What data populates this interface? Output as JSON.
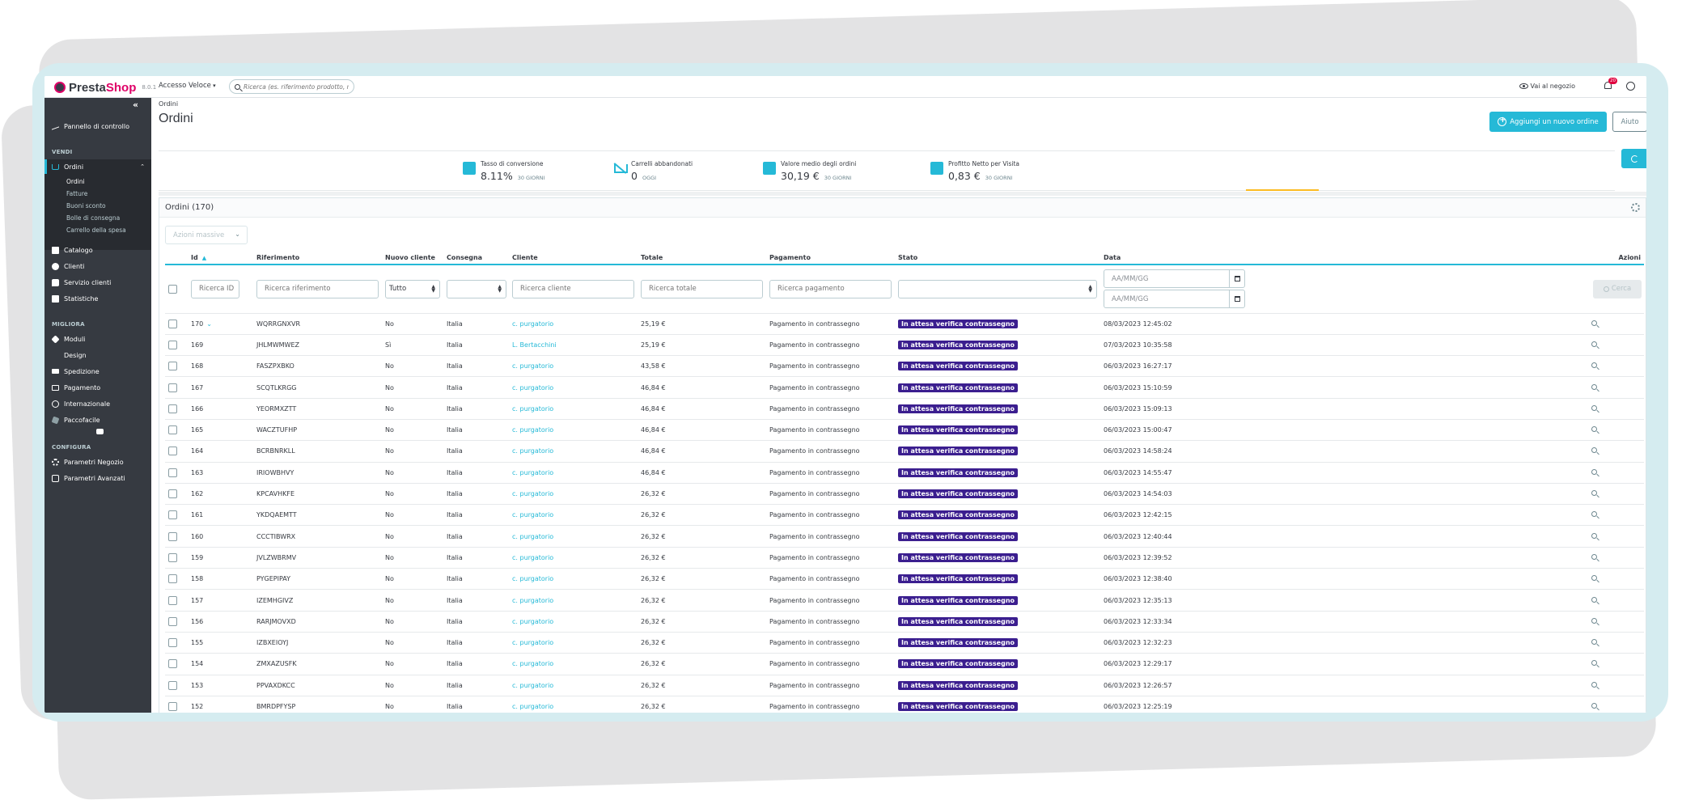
{
  "app": {
    "logo_main": "Presta",
    "logo_accent": "Shop",
    "version": "8.0.1",
    "quick_access": "Accesso Veloce",
    "search_placeholder": "Ricerca (es. riferimento prodotto, nom",
    "shop_link": "Vai al negozio",
    "notification_count": "20"
  },
  "sidebar": {
    "dashboard": "Pannello di controllo",
    "section_sell": "VENDI",
    "orders": "Ordini",
    "orders_sub": [
      "Ordini",
      "Fatture",
      "Buoni sconto",
      "Bolle di consegna",
      "Carrello della spesa"
    ],
    "catalog": "Catalogo",
    "customers": "Clienti",
    "customer_service": "Servizio clienti",
    "stats": "Statistiche",
    "section_improve": "MIGLIORA",
    "modules": "Moduli",
    "design": "Design",
    "shipping": "Spedizione",
    "payment": "Pagamento",
    "international": "Internazionale",
    "paccofacile": "Paccofacile",
    "section_configure": "CONFIGURA",
    "shop_params": "Parametri Negozio",
    "advanced_params": "Parametri Avanzati"
  },
  "header": {
    "breadcrumb": "Ordini",
    "title": "Ordini",
    "add_order": "Aggiungi un nuovo ordine",
    "help": "Aiuto"
  },
  "kpis": [
    {
      "label": "Tasso di conversione",
      "value": "8.11%",
      "period": "30 GIORNI"
    },
    {
      "label": "Carrelli abbandonati",
      "value": "0",
      "period": "OGGI"
    },
    {
      "label": "Valore medio degli ordini",
      "value": "30,19 €",
      "period": "30 GIORNI"
    },
    {
      "label": "Profitto Netto per Visita",
      "value": "0,83 €",
      "period": "30 GIORNI"
    }
  ],
  "panel": {
    "title": "Ordini (170)",
    "bulk_actions": "Azioni massive"
  },
  "table": {
    "headers": {
      "id": "Id",
      "reference": "Riferimento",
      "new_client": "Nuovo cliente",
      "delivery": "Consegna",
      "customer": "Cliente",
      "total": "Totale",
      "payment": "Pagamento",
      "status": "Stato",
      "date": "Data",
      "actions": "Azioni"
    },
    "filters": {
      "id": "Ricerca ID",
      "reference": "Ricerca riferimento",
      "new_client": "Tutto",
      "customer": "Ricerca cliente",
      "total": "Ricerca totale",
      "payment": "Ricerca pagamento",
      "date_from": "AA/MM/GG",
      "date_to": "AA/MM/GG",
      "search": "Cerca"
    },
    "rows": [
      {
        "id": "170",
        "ref": "WQRRGNXVR",
        "new": "No",
        "country": "Italia",
        "customer": "c. purgatorio",
        "total": "25,19 €",
        "payment": "Pagamento in contrassegno",
        "status": "In attesa verifica contrassegno",
        "date": "08/03/2023 12:45:02"
      },
      {
        "id": "169",
        "ref": "JHLMWMWEZ",
        "new": "Sì",
        "country": "Italia",
        "customer": "L. Bertacchini",
        "total": "25,19 €",
        "payment": "Pagamento in contrassegno",
        "status": "In attesa verifica contrassegno",
        "date": "07/03/2023 10:35:58"
      },
      {
        "id": "168",
        "ref": "FASZPXBKO",
        "new": "No",
        "country": "Italia",
        "customer": "c. purgatorio",
        "total": "43,58 €",
        "payment": "Pagamento in contrassegno",
        "status": "In attesa verifica contrassegno",
        "date": "06/03/2023 16:27:17"
      },
      {
        "id": "167",
        "ref": "SCQTLKRGG",
        "new": "No",
        "country": "Italia",
        "customer": "c. purgatorio",
        "total": "46,84 €",
        "payment": "Pagamento in contrassegno",
        "status": "In attesa verifica contrassegno",
        "date": "06/03/2023 15:10:59"
      },
      {
        "id": "166",
        "ref": "YEORMXZTT",
        "new": "No",
        "country": "Italia",
        "customer": "c. purgatorio",
        "total": "46,84 €",
        "payment": "Pagamento in contrassegno",
        "status": "In attesa verifica contrassegno",
        "date": "06/03/2023 15:09:13"
      },
      {
        "id": "165",
        "ref": "WACZTUFHP",
        "new": "No",
        "country": "Italia",
        "customer": "c. purgatorio",
        "total": "46,84 €",
        "payment": "Pagamento in contrassegno",
        "status": "In attesa verifica contrassegno",
        "date": "06/03/2023 15:00:47"
      },
      {
        "id": "164",
        "ref": "BCRBNRKLL",
        "new": "No",
        "country": "Italia",
        "customer": "c. purgatorio",
        "total": "46,84 €",
        "payment": "Pagamento in contrassegno",
        "status": "In attesa verifica contrassegno",
        "date": "06/03/2023 14:58:24"
      },
      {
        "id": "163",
        "ref": "IRIOWBHVY",
        "new": "No",
        "country": "Italia",
        "customer": "c. purgatorio",
        "total": "46,84 €",
        "payment": "Pagamento in contrassegno",
        "status": "In attesa verifica contrassegno",
        "date": "06/03/2023 14:55:47"
      },
      {
        "id": "162",
        "ref": "KPCAVHKFE",
        "new": "No",
        "country": "Italia",
        "customer": "c. purgatorio",
        "total": "26,32 €",
        "payment": "Pagamento in contrassegno",
        "status": "In attesa verifica contrassegno",
        "date": "06/03/2023 14:54:03"
      },
      {
        "id": "161",
        "ref": "YKDQAEMTT",
        "new": "No",
        "country": "Italia",
        "customer": "c. purgatorio",
        "total": "26,32 €",
        "payment": "Pagamento in contrassegno",
        "status": "In attesa verifica contrassegno",
        "date": "06/03/2023 12:42:15"
      },
      {
        "id": "160",
        "ref": "CCCTIBWRX",
        "new": "No",
        "country": "Italia",
        "customer": "c. purgatorio",
        "total": "26,32 €",
        "payment": "Pagamento in contrassegno",
        "status": "In attesa verifica contrassegno",
        "date": "06/03/2023 12:40:44"
      },
      {
        "id": "159",
        "ref": "JVLZWBRMV",
        "new": "No",
        "country": "Italia",
        "customer": "c. purgatorio",
        "total": "26,32 €",
        "payment": "Pagamento in contrassegno",
        "status": "In attesa verifica contrassegno",
        "date": "06/03/2023 12:39:52"
      },
      {
        "id": "158",
        "ref": "PYGEPIPAY",
        "new": "No",
        "country": "Italia",
        "customer": "c. purgatorio",
        "total": "26,32 €",
        "payment": "Pagamento in contrassegno",
        "status": "In attesa verifica contrassegno",
        "date": "06/03/2023 12:38:40"
      },
      {
        "id": "157",
        "ref": "IZEMHGIVZ",
        "new": "No",
        "country": "Italia",
        "customer": "c. purgatorio",
        "total": "26,32 €",
        "payment": "Pagamento in contrassegno",
        "status": "In attesa verifica contrassegno",
        "date": "06/03/2023 12:35:13"
      },
      {
        "id": "156",
        "ref": "RARJMOVXD",
        "new": "No",
        "country": "Italia",
        "customer": "c. purgatorio",
        "total": "26,32 €",
        "payment": "Pagamento in contrassegno",
        "status": "In attesa verifica contrassegno",
        "date": "06/03/2023 12:33:34"
      },
      {
        "id": "155",
        "ref": "IZBXEIOYJ",
        "new": "No",
        "country": "Italia",
        "customer": "c. purgatorio",
        "total": "26,32 €",
        "payment": "Pagamento in contrassegno",
        "status": "In attesa verifica contrassegno",
        "date": "06/03/2023 12:32:23"
      },
      {
        "id": "154",
        "ref": "ZMXAZUSFK",
        "new": "No",
        "country": "Italia",
        "customer": "c. purgatorio",
        "total": "26,32 €",
        "payment": "Pagamento in contrassegno",
        "status": "In attesa verifica contrassegno",
        "date": "06/03/2023 12:29:17"
      },
      {
        "id": "153",
        "ref": "PPVAXDKCC",
        "new": "No",
        "country": "Italia",
        "customer": "c. purgatorio",
        "total": "26,32 €",
        "payment": "Pagamento in contrassegno",
        "status": "In attesa verifica contrassegno",
        "date": "06/03/2023 12:26:57"
      },
      {
        "id": "152",
        "ref": "BMRDPFYSP",
        "new": "No",
        "country": "Italia",
        "customer": "c. purgatorio",
        "total": "26,32 €",
        "payment": "Pagamento in contrassegno",
        "status": "In attesa verifica contrassegno",
        "date": "06/03/2023 12:25:19"
      }
    ]
  },
  "colors": {
    "accent": "#25b9d7",
    "sidebar": "#363a41",
    "status_badge": "#3b1e8f",
    "brand": "#df0067"
  }
}
